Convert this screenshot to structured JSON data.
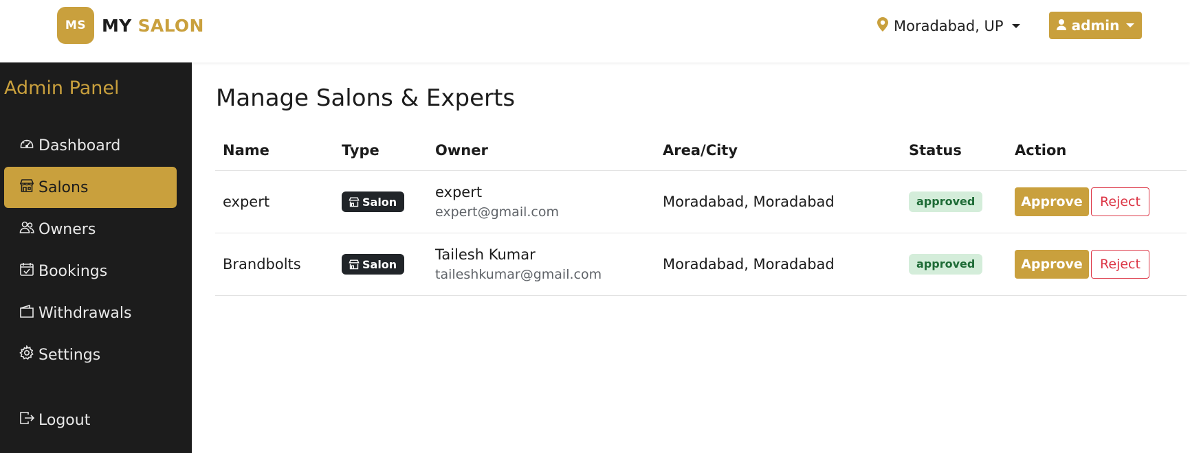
{
  "header": {
    "logo_initials": "MS",
    "brand_part1": "MY",
    "brand_part2": "SALON",
    "location": "Moradabad, UP",
    "user": "admin"
  },
  "sidebar": {
    "title": "Admin Panel",
    "items": [
      {
        "label": "Dashboard",
        "icon": "speedometer-icon",
        "active": false
      },
      {
        "label": "Salons",
        "icon": "shop-icon",
        "active": true
      },
      {
        "label": "Owners",
        "icon": "people-icon",
        "active": false
      },
      {
        "label": "Bookings",
        "icon": "calendar-check-icon",
        "active": false
      },
      {
        "label": "Withdrawals",
        "icon": "wallet-icon",
        "active": false
      },
      {
        "label": "Settings",
        "icon": "gear-icon",
        "active": false
      }
    ],
    "logout": {
      "label": "Logout",
      "icon": "logout-icon"
    }
  },
  "main": {
    "title": "Manage Salons & Experts",
    "table": {
      "headers": [
        "Name",
        "Type",
        "Owner",
        "Area/City",
        "Status",
        "Action"
      ],
      "rows": [
        {
          "name": "expert",
          "type": "Salon",
          "owner_name": "expert",
          "owner_email": "expert@gmail.com",
          "area": "Moradabad, Moradabad",
          "status": "approved",
          "approve": "Approve",
          "reject": "Reject"
        },
        {
          "name": "Brandbolts",
          "type": "Salon",
          "owner_name": "Tailesh Kumar",
          "owner_email": "taileshkumar@gmail.com",
          "area": "Moradabad, Moradabad",
          "status": "approved",
          "approve": "Approve",
          "reject": "Reject"
        }
      ]
    }
  },
  "colors": {
    "accent": "#c9a03d",
    "sidebar_bg": "#1c1c1c",
    "status_bg": "#d4edda",
    "status_text": "#1e6b36",
    "reject": "#dc3545"
  }
}
